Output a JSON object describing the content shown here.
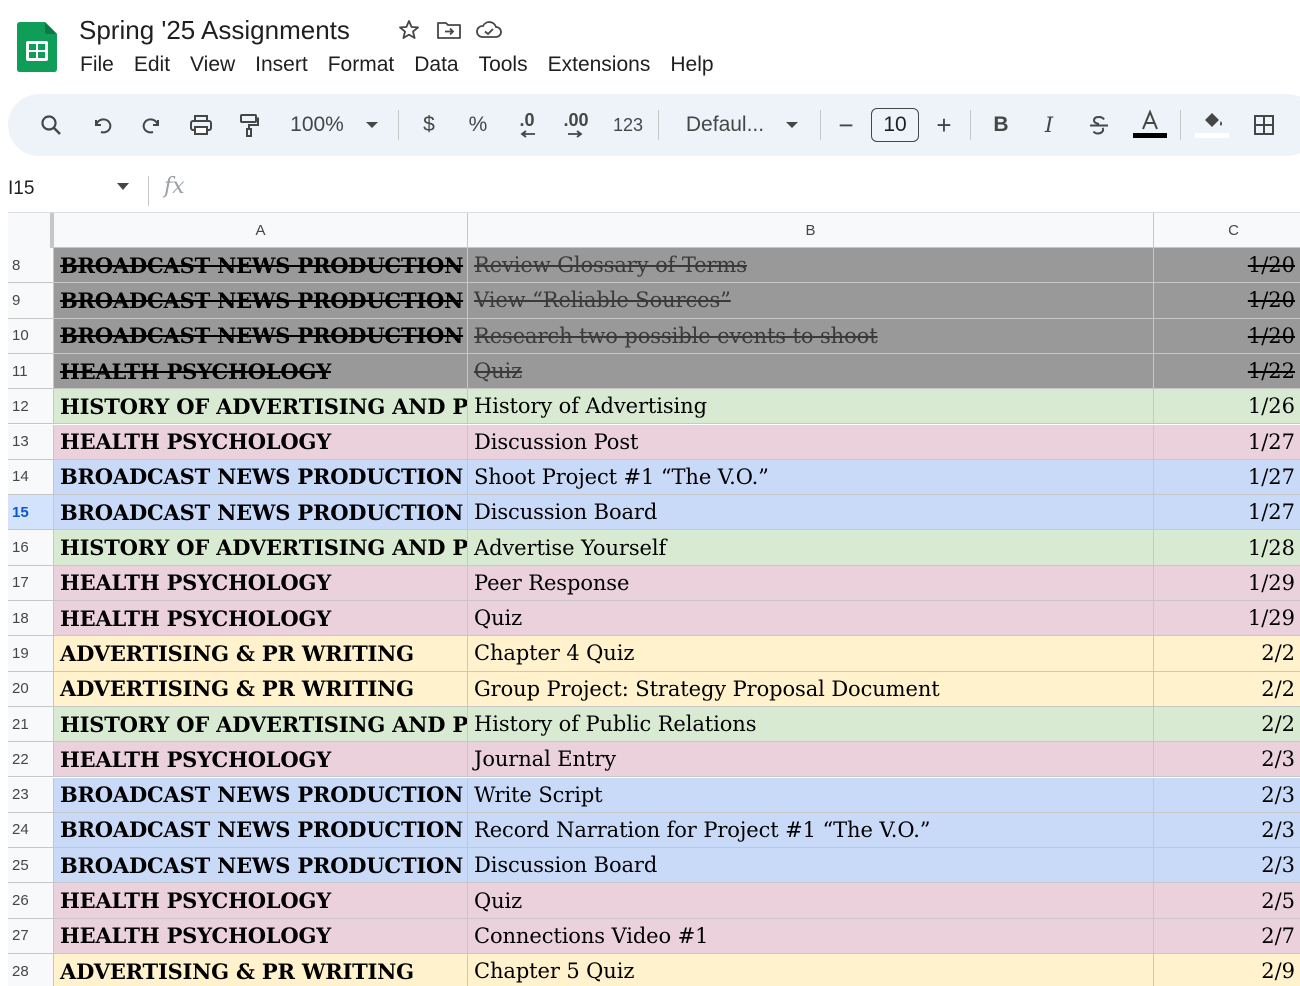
{
  "app": {
    "doc_title": "Spring '25 Assignments",
    "menu": [
      "File",
      "Edit",
      "View",
      "Insert",
      "Format",
      "Data",
      "Tools",
      "Extensions",
      "Help"
    ]
  },
  "toolbar": {
    "zoom": "100%",
    "currency": "$",
    "percent": "%",
    "decrease_decimal": ".0",
    "increase_decimal": ".00",
    "number_format": "123",
    "font": "Defaul...",
    "minus": "−",
    "font_size": "10",
    "plus": "+",
    "bold": "B",
    "italic": "I"
  },
  "formula_bar": {
    "cell_ref": "I15",
    "fx": "fx"
  },
  "colors": {
    "done": "#999999",
    "history_adv_pr": "#d9ead3",
    "health_psych": "#ead1dc",
    "broadcast": "#c9daf8",
    "adv_pr_writing": "#fff2cc"
  },
  "columns": [
    "A",
    "B",
    "C"
  ],
  "active_row": "15",
  "rows": [
    {
      "n": "8",
      "a": "BROADCAST NEWS PRODUCTION",
      "b": "Review Glossary of Terms",
      "c": "1/20",
      "cat": "done"
    },
    {
      "n": "9",
      "a": "BROADCAST NEWS PRODUCTION",
      "b": "View “Reliable Sources”",
      "c": "1/20",
      "cat": "done"
    },
    {
      "n": "10",
      "a": "BROADCAST NEWS PRODUCTION",
      "b": "Research two possible events to shoot",
      "c": "1/20",
      "cat": "done"
    },
    {
      "n": "11",
      "a": "HEALTH PSYCHOLOGY",
      "b": "Quiz",
      "c": "1/22",
      "cat": "done"
    },
    {
      "n": "12",
      "a": "HISTORY OF ADVERTISING AND PR",
      "b": "History of Advertising",
      "c": "1/26",
      "cat": "history_adv_pr"
    },
    {
      "n": "13",
      "a": "HEALTH PSYCHOLOGY",
      "b": "Discussion Post",
      "c": "1/27",
      "cat": "health_psych"
    },
    {
      "n": "14",
      "a": "BROADCAST NEWS PRODUCTION",
      "b": "Shoot Project #1 “The V.O.”",
      "c": "1/27",
      "cat": "broadcast"
    },
    {
      "n": "15",
      "a": "BROADCAST NEWS PRODUCTION",
      "b": "Discussion Board",
      "c": "1/27",
      "cat": "broadcast"
    },
    {
      "n": "16",
      "a": "HISTORY OF ADVERTISING AND PR",
      "b": "Advertise Yourself",
      "c": "1/28",
      "cat": "history_adv_pr"
    },
    {
      "n": "17",
      "a": "HEALTH PSYCHOLOGY",
      "b": "Peer Response",
      "c": "1/29",
      "cat": "health_psych"
    },
    {
      "n": "18",
      "a": "HEALTH PSYCHOLOGY",
      "b": "Quiz",
      "c": "1/29",
      "cat": "health_psych"
    },
    {
      "n": "19",
      "a": "ADVERTISING & PR WRITING",
      "b": "Chapter 4 Quiz",
      "c": "2/2",
      "cat": "adv_pr_writing"
    },
    {
      "n": "20",
      "a": "ADVERTISING & PR WRITING",
      "b": "Group Project: Strategy Proposal Document",
      "c": "2/2",
      "cat": "adv_pr_writing"
    },
    {
      "n": "21",
      "a": "HISTORY OF ADVERTISING AND PR",
      "b": "History of Public Relations",
      "c": "2/2",
      "cat": "history_adv_pr"
    },
    {
      "n": "22",
      "a": "HEALTH PSYCHOLOGY",
      "b": "Journal Entry",
      "c": "2/3",
      "cat": "health_psych"
    },
    {
      "n": "23",
      "a": "BROADCAST NEWS PRODUCTION",
      "b": "Write Script",
      "c": "2/3",
      "cat": "broadcast"
    },
    {
      "n": "24",
      "a": "BROADCAST NEWS PRODUCTION",
      "b": "Record Narration for Project #1 “The V.O.”",
      "c": "2/3",
      "cat": "broadcast"
    },
    {
      "n": "25",
      "a": "BROADCAST NEWS PRODUCTION",
      "b": "Discussion Board",
      "c": "2/3",
      "cat": "broadcast"
    },
    {
      "n": "26",
      "a": "HEALTH PSYCHOLOGY",
      "b": "Quiz",
      "c": "2/5",
      "cat": "health_psych"
    },
    {
      "n": "27",
      "a": "HEALTH PSYCHOLOGY",
      "b": "Connections Video #1",
      "c": "2/7",
      "cat": "health_psych"
    },
    {
      "n": "28",
      "a": "ADVERTISING & PR WRITING",
      "b": "Chapter 5 Quiz",
      "c": "2/9",
      "cat": "adv_pr_writing"
    }
  ]
}
